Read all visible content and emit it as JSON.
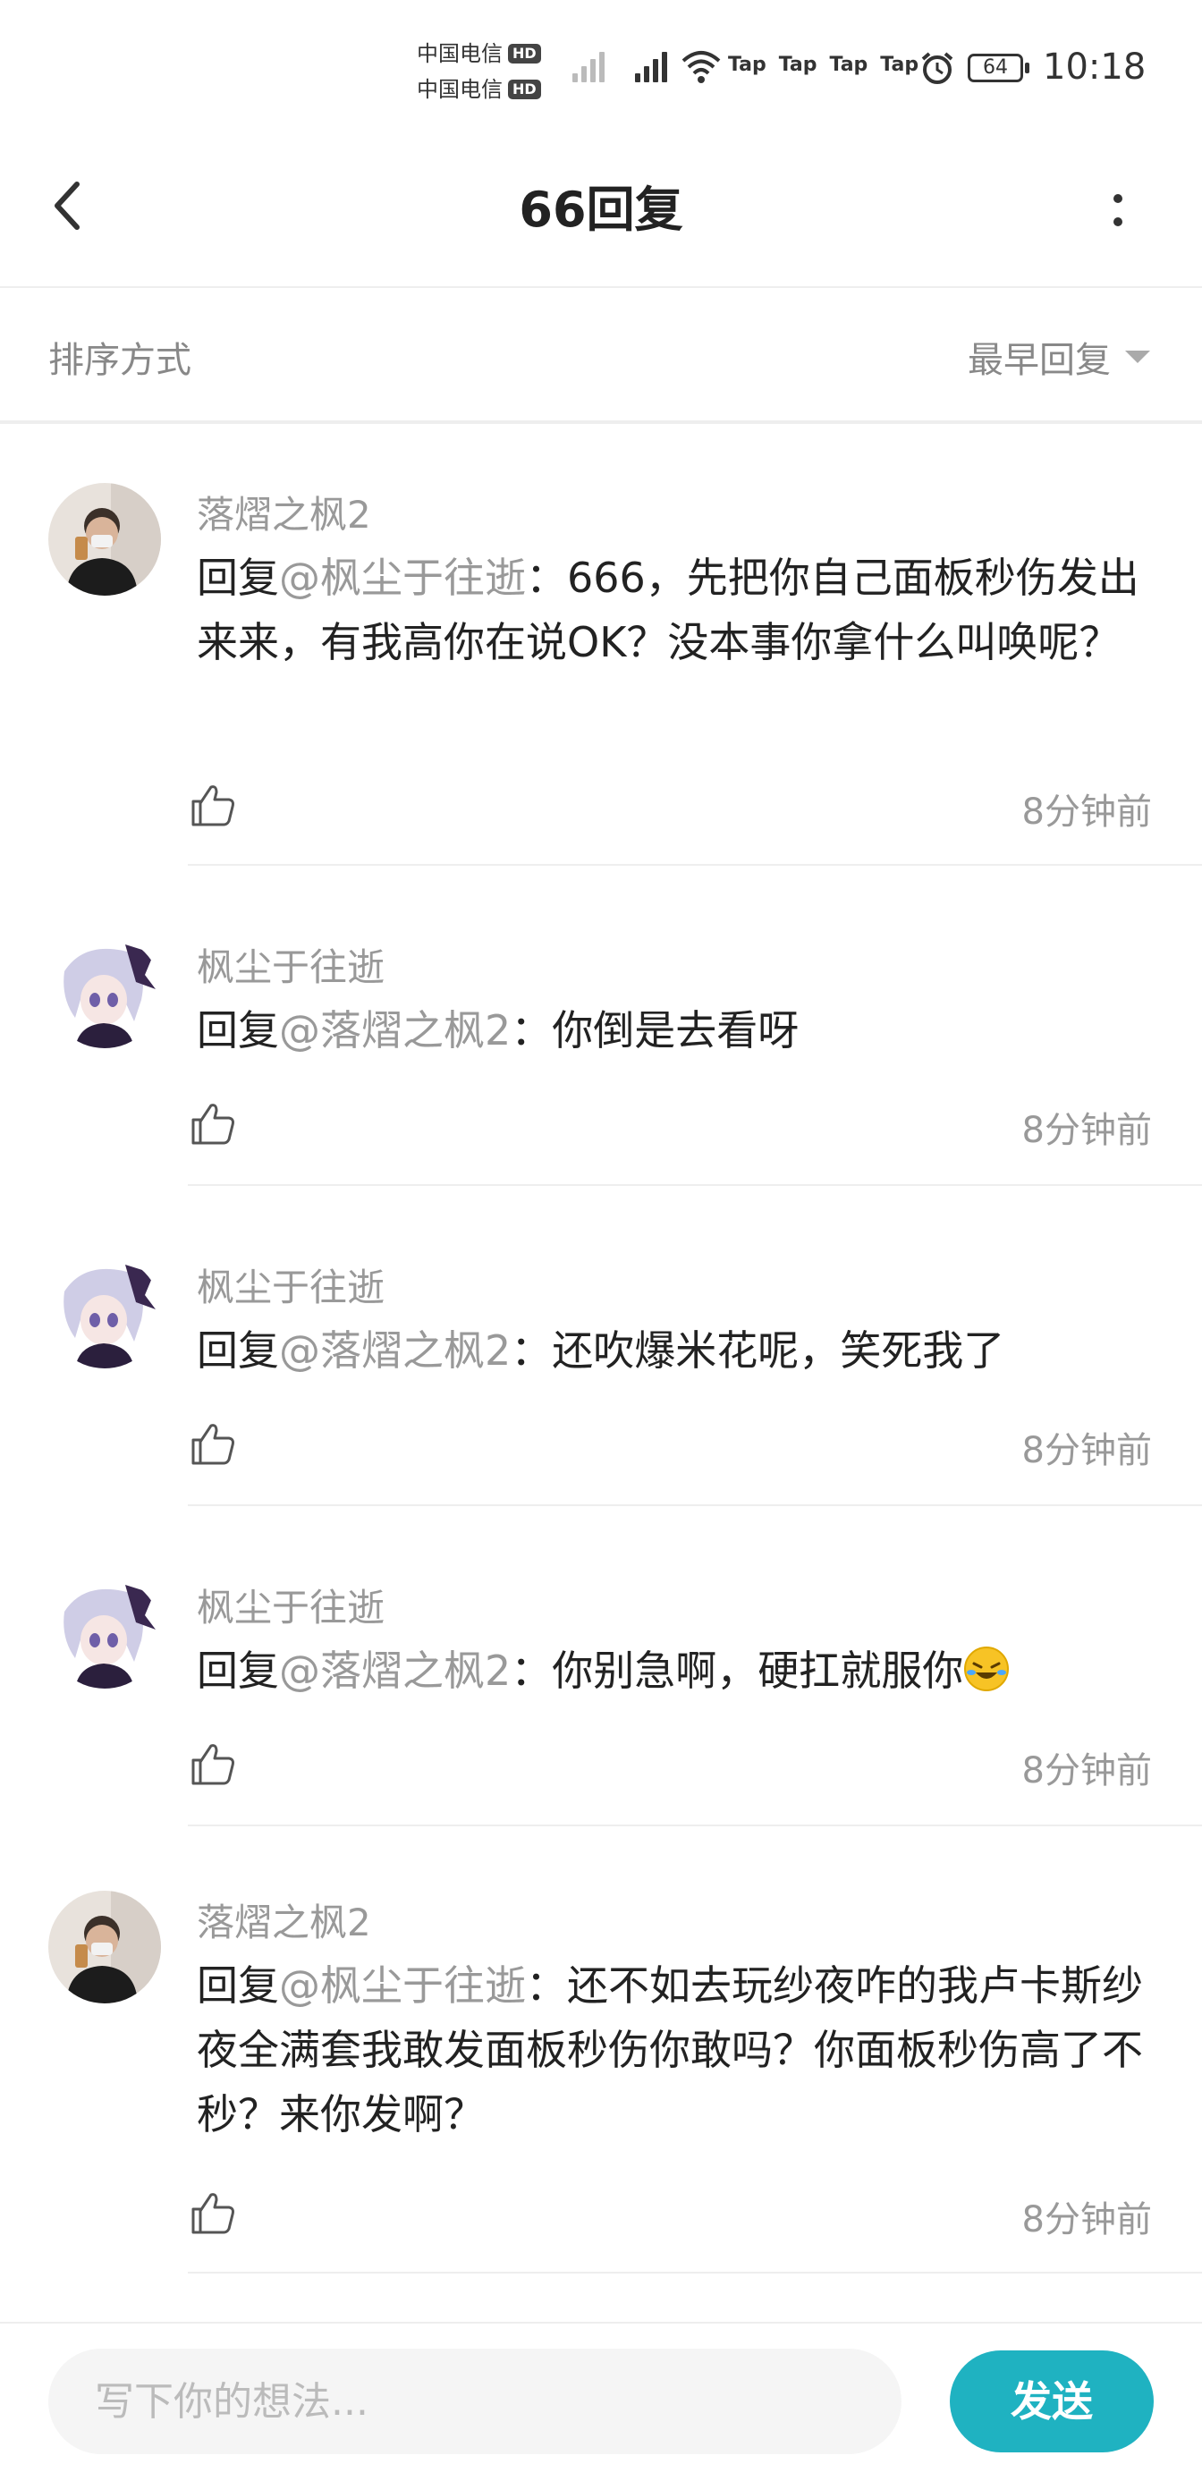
{
  "status_bar": {
    "carrier1": "中国电信",
    "carrier2": "中国电信",
    "hd": "HD",
    "tap_labels": [
      "Tap",
      "Tap",
      "Tap",
      "Tap"
    ],
    "battery": "64",
    "time": "10:18"
  },
  "header": {
    "title": "66回复",
    "back_icon": "chevron-left-icon",
    "more_icon": "more-vertical-icon"
  },
  "sort": {
    "label": "排序方式",
    "selected": "最早回复"
  },
  "comments": [
    {
      "user": "落熠之枫2",
      "reply_prefix": "回复",
      "mention": "@枫尘于往逝",
      "text": "：666，先把你自己面板秒伤发出来来，有我高你在说OK？没本事你拿什么叫唤呢？",
      "time": "8分钟前"
    },
    {
      "user": "枫尘于往逝",
      "reply_prefix": "回复",
      "mention": "@落熠之枫2",
      "text": "：你倒是去看呀",
      "time": "8分钟前"
    },
    {
      "user": "枫尘于往逝",
      "reply_prefix": "回复",
      "mention": "@落熠之枫2",
      "text": "：还吹爆米花呢，笑死我了",
      "time": "8分钟前"
    },
    {
      "user": "枫尘于往逝",
      "reply_prefix": "回复",
      "mention": "@落熠之枫2",
      "text": "：你别急啊，硬扛就服你",
      "time": "8分钟前"
    },
    {
      "user": "落熠之枫2",
      "reply_prefix": "回复",
      "mention": "@枫尘于往逝",
      "text": "：还不如去玩纱夜咋的我卢卡斯纱夜全满套我敢发面板秒伤你敢吗？你面板秒伤高了不秒？来你发啊？",
      "time": "8分钟前"
    }
  ],
  "composer": {
    "placeholder": "写下你的想法...",
    "send_label": "发送"
  },
  "colors": {
    "accent": "#1fb2c1",
    "muted_text": "#999999",
    "divider": "#eeeeee"
  }
}
